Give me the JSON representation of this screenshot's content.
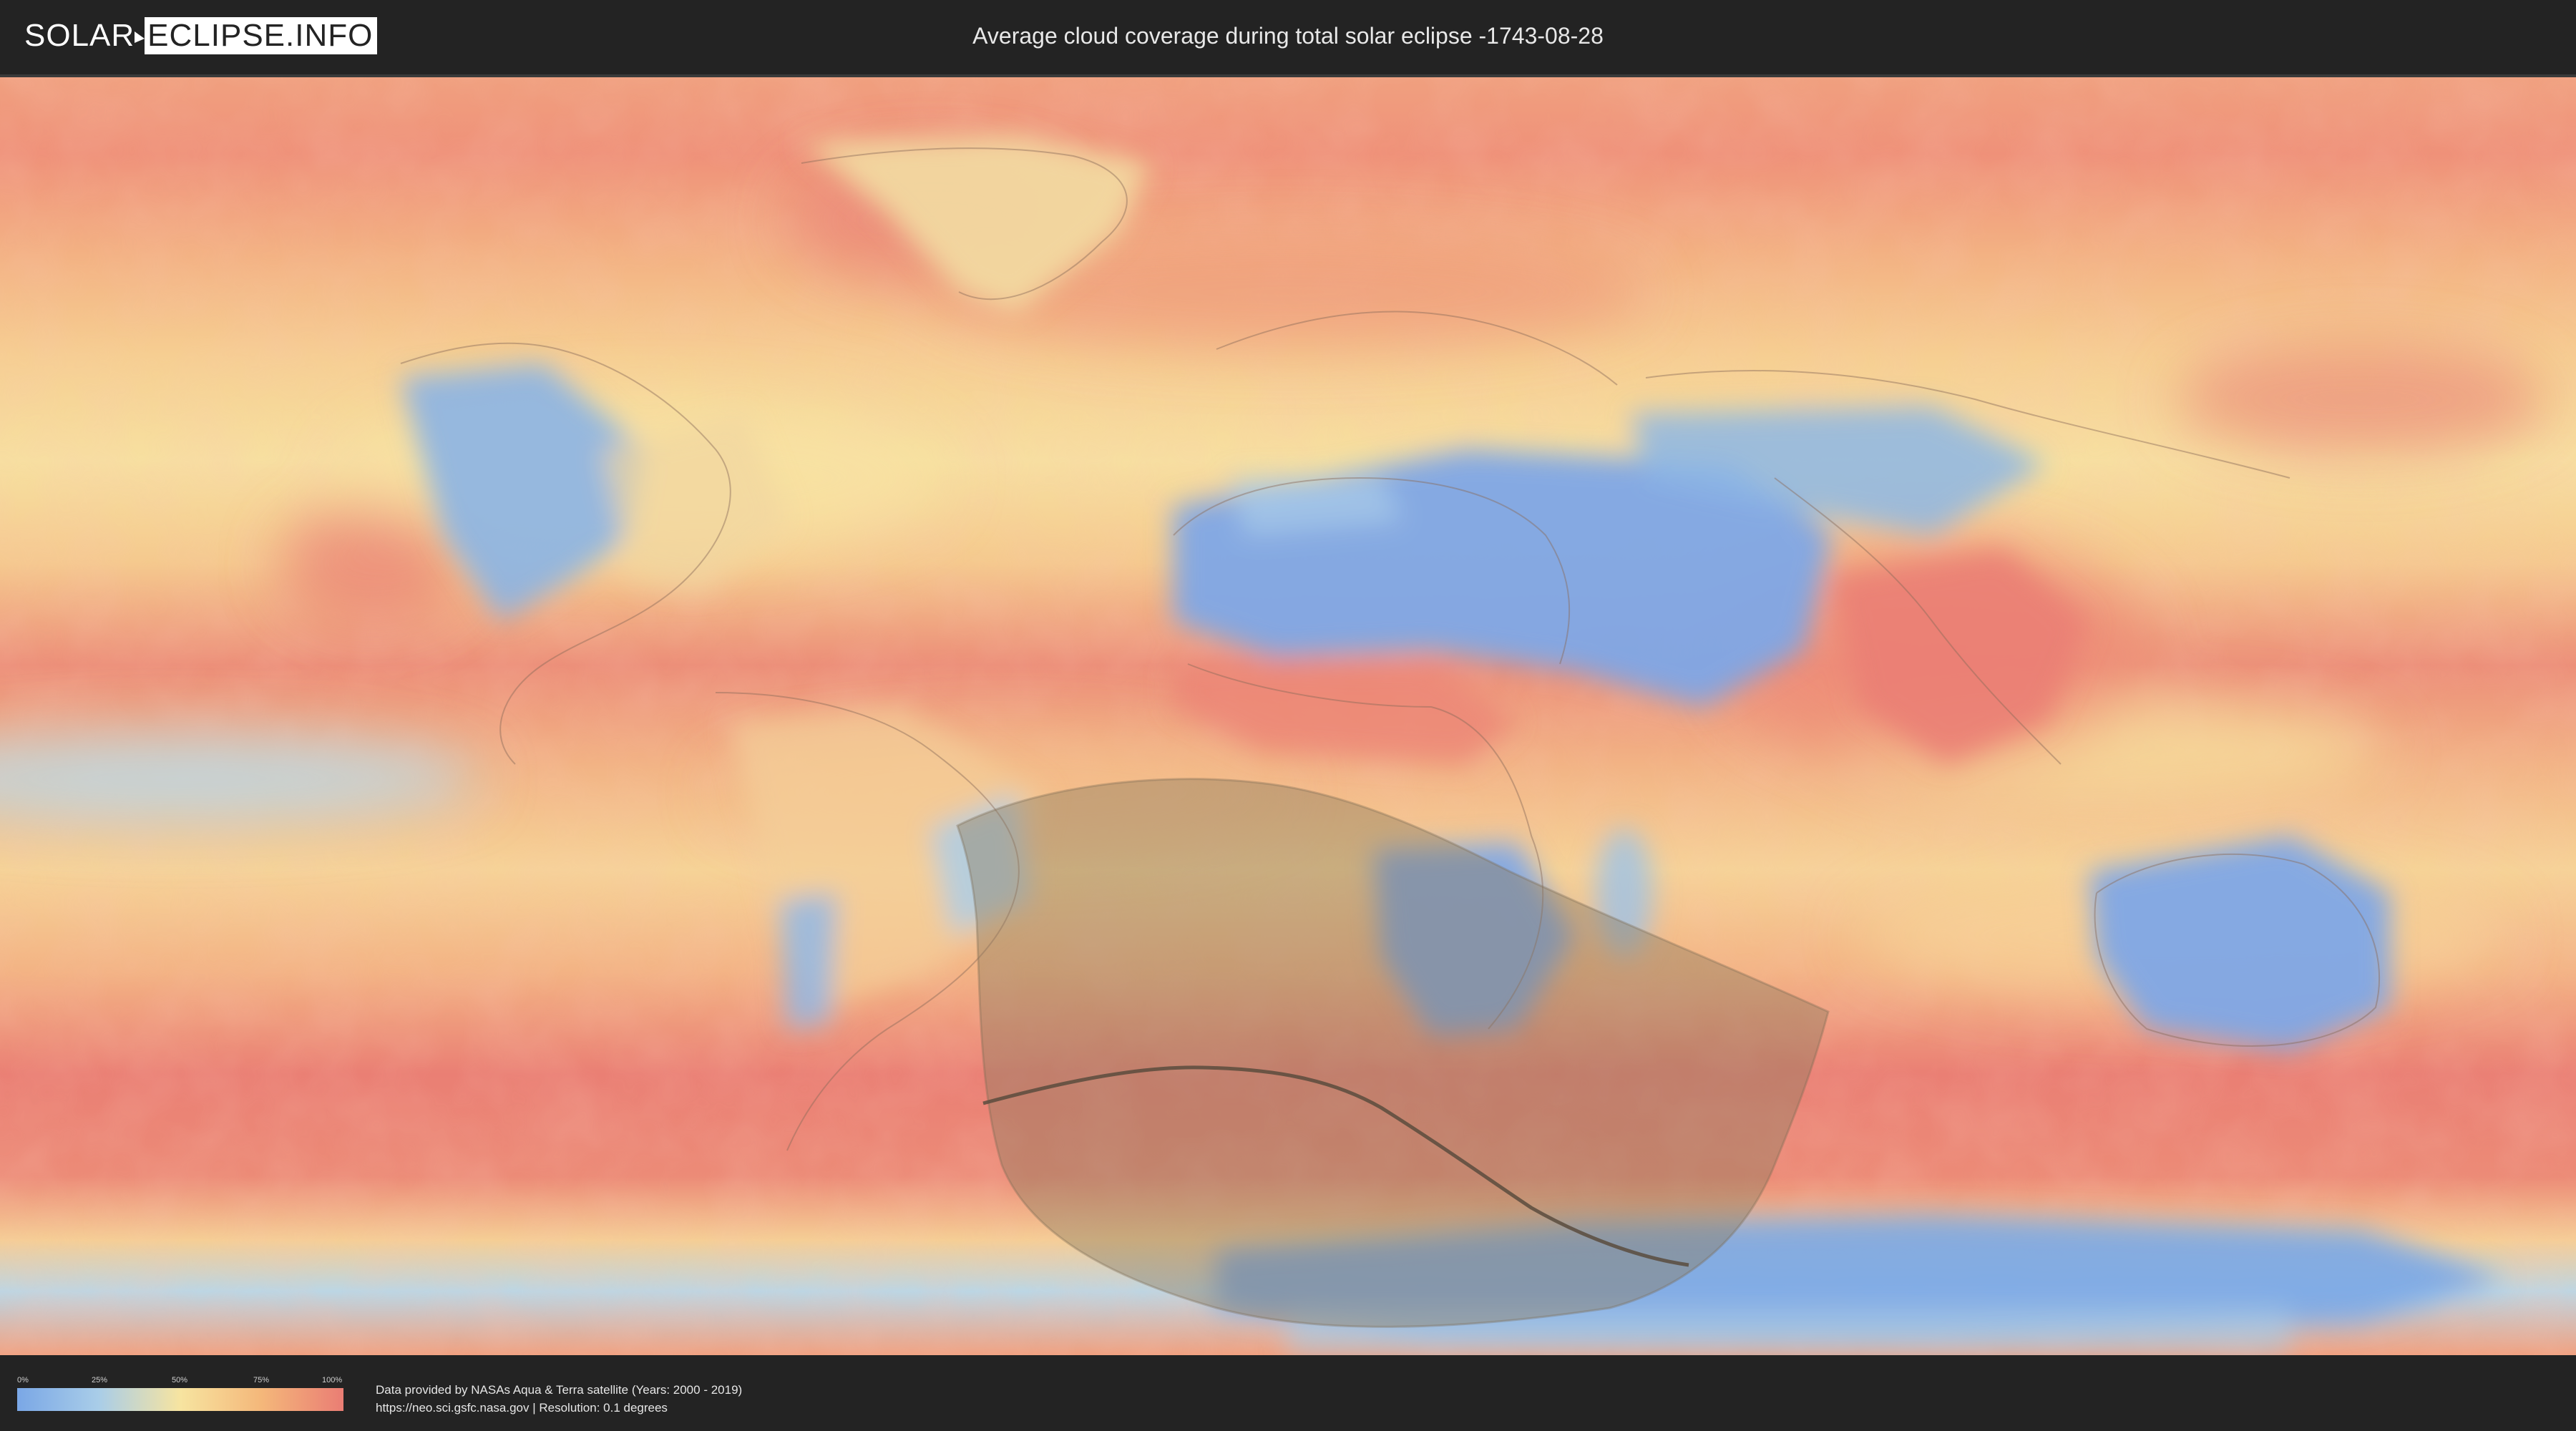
{
  "header": {
    "logo_left": "SOLAR",
    "logo_right": "ECLIPSE.INFO",
    "title": "Average cloud coverage during total solar eclipse -1743-08-28"
  },
  "map": {
    "layer": "average cloud coverage",
    "overlay": "eclipse visibility zone with path of totality",
    "colors": {
      "clear": "#7aa7e6",
      "low": "#a9cde8",
      "mid": "#f7e4a0",
      "high": "#f4b77a",
      "overcast": "#ea7d74",
      "shadow_zone": "#8a7a5c",
      "totality_path": "#5a4c3e"
    }
  },
  "legend": {
    "ticks": [
      "0%",
      "25%",
      "50%",
      "75%",
      "100%"
    ],
    "gradient": [
      "#7aa7e6",
      "#a9cde8",
      "#f7e4a0",
      "#f4b77a",
      "#ea7d74"
    ]
  },
  "footer": {
    "credit_line1": "Data provided by NASAs Aqua & Terra satellite (Years: 2000 - 2019)",
    "credit_line2": "https://neo.sci.gsfc.nasa.gov | Resolution: 0.1 degrees"
  }
}
